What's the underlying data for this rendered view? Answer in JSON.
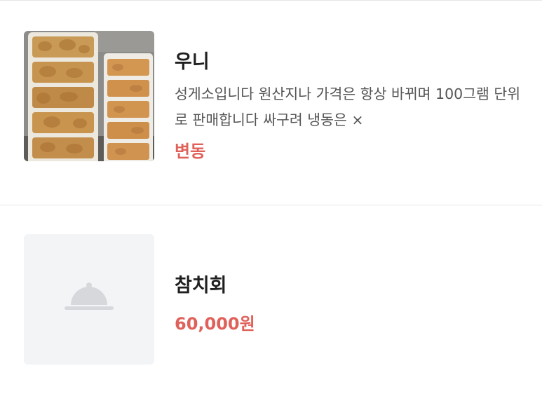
{
  "menu": {
    "items": [
      {
        "name": "우니",
        "description": "성게소입니다 원산지나 가격은 항상 바뀌며 100그램 단위로 판매합니다 싸구려 냉동은 ×",
        "price": "변동",
        "image": "sea-urchin-photo"
      },
      {
        "name": "참치회",
        "price": "60,000원",
        "image": "cloche-placeholder-icon"
      }
    ]
  },
  "colors": {
    "price_accent": "#e0605a",
    "placeholder_bg": "#f3f4f6",
    "placeholder_icon": "#d6d8db",
    "divider": "#e6e6e6"
  }
}
